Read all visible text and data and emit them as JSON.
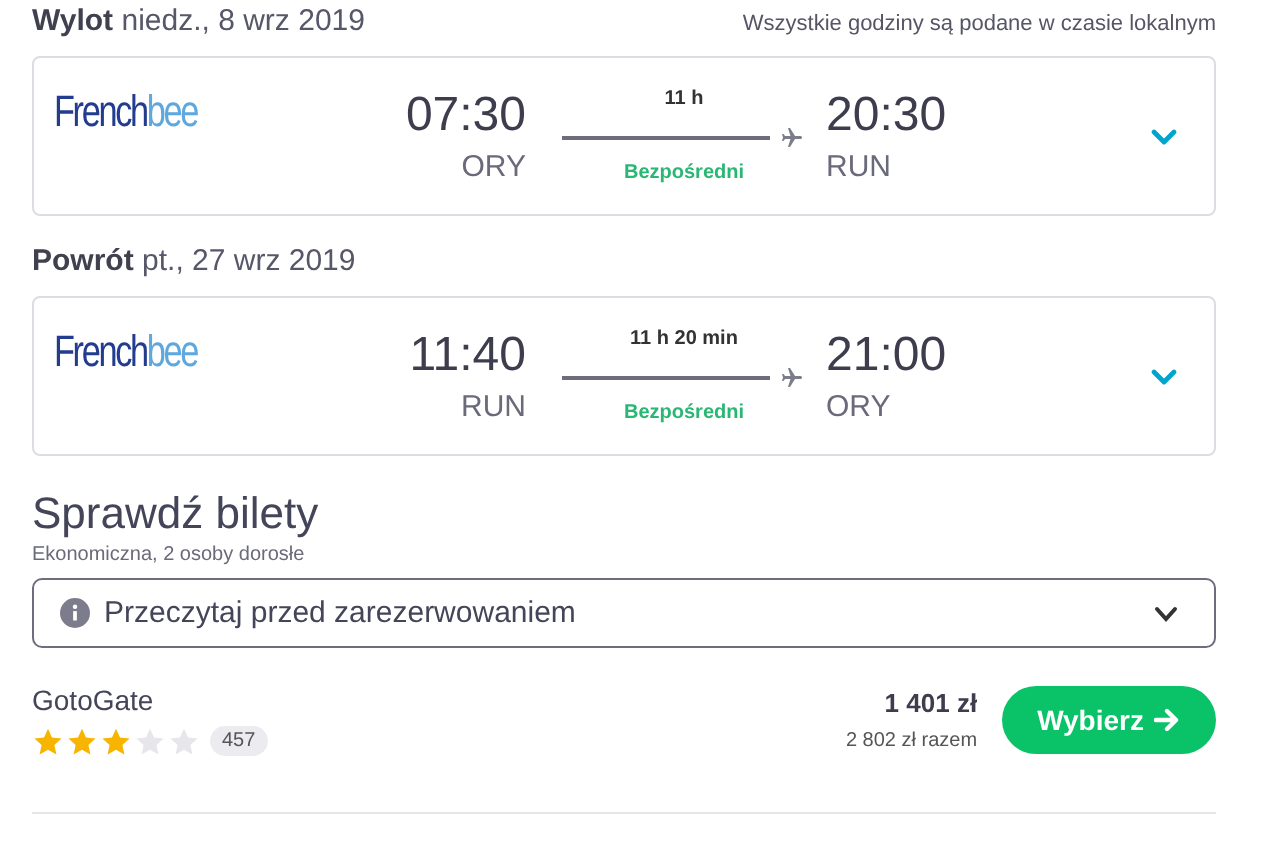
{
  "note": "Wszystkie godziny są podane w czasie lokalnym",
  "legs": [
    {
      "label": "Wylot",
      "date": "niedz., 8 wrz 2019",
      "airline": [
        "French",
        "bee"
      ],
      "depart_time": "07:30",
      "depart_airport": "ORY",
      "duration": "11 h",
      "stops": "Bezpośredni",
      "arrive_time": "20:30",
      "arrive_airport": "RUN",
      "expanded": false
    },
    {
      "label": "Powrót",
      "date": "pt., 27 wrz 2019",
      "airline": [
        "French",
        "bee"
      ],
      "depart_time": "11:40",
      "depart_airport": "RUN",
      "duration": "11 h 20 min",
      "stops": "Bezpośredni",
      "arrive_time": "21:00",
      "arrive_airport": "ORY",
      "expanded": false
    }
  ],
  "tickets": {
    "title": "Sprawdź bilety",
    "subtitle": "Ekonomiczna, 2 osoby dorosłe",
    "notice": "Przeczytaj przed zarezerwowaniem",
    "notice_expanded": false,
    "provider": {
      "name": "GotoGate",
      "stars": 3,
      "reviews": "457",
      "price": "1 401 zł",
      "total": "2 802 zł razem",
      "button": "Wybierz"
    }
  }
}
